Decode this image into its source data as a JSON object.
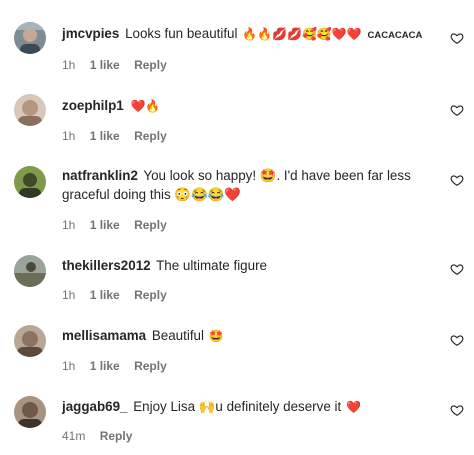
{
  "comments": [
    {
      "username": "jmcvpies",
      "text": "Looks fun beautiful",
      "emoji": "🔥🔥💋💋🥰🥰❤️❤️",
      "extra": "CACACACA",
      "time": "1h",
      "likes": "1 like",
      "reply": "Reply",
      "avatar_color": "#5a6b7a"
    },
    {
      "username": "zoephilp1",
      "text": "",
      "emoji": "❤️🔥",
      "extra": "",
      "time": "1h",
      "likes": "1 like",
      "reply": "Reply",
      "avatar_color": "#c9b6a6"
    },
    {
      "username": "natfranklin2",
      "text": "You look so happy! 🤩. I'd have been far less graceful doing this 😳😂😂❤️",
      "emoji": "",
      "extra": "",
      "time": "1h",
      "likes": "1 like",
      "reply": "Reply",
      "avatar_color": "#6f8a3c"
    },
    {
      "username": "thekillers2012",
      "text": "The ultimate figure",
      "emoji": "",
      "extra": "",
      "time": "1h",
      "likes": "1 like",
      "reply": "Reply",
      "avatar_color": "#8a8a78"
    },
    {
      "username": "mellisamama",
      "text": "Beautiful",
      "emoji": "🤩",
      "extra": "",
      "time": "1h",
      "likes": "1 like",
      "reply": "Reply",
      "avatar_color": "#9c8570"
    },
    {
      "username": "jaggab69_",
      "text": "Enjoy Lisa 🙌u definitely deserve it",
      "emoji": "❤️",
      "extra": "",
      "time": "41m",
      "likes": "",
      "reply": "Reply",
      "avatar_color": "#7b6654"
    }
  ],
  "colors": {
    "text": "#262626",
    "meta": "#737373",
    "heart": "#e0245e"
  },
  "icons": {
    "like": "heart-outline-icon"
  }
}
